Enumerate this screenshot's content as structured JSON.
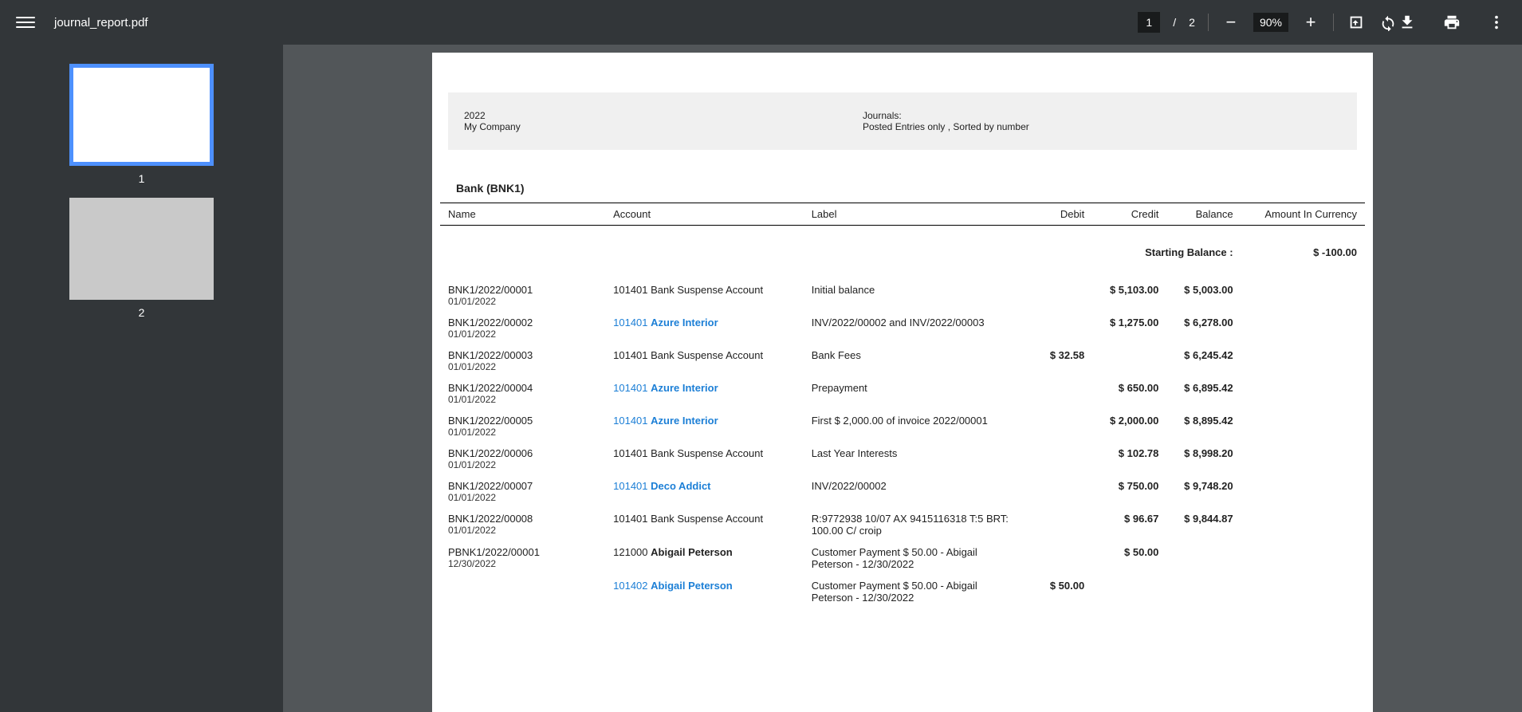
{
  "toolbar": {
    "filename": "journal_report.pdf",
    "page_current": "1",
    "page_total": "2",
    "page_sep": "/",
    "zoom": "90%"
  },
  "thumbnails": {
    "page1": "1",
    "page2": "2"
  },
  "report": {
    "year": "2022",
    "company": "My Company",
    "journals_label": "Journals:",
    "filter_text": "Posted Entries only , Sorted by number",
    "section": "Bank (BNK1)",
    "columns": {
      "name": "Name",
      "account": "Account",
      "label": "Label",
      "debit": "Debit",
      "credit": "Credit",
      "balance": "Balance",
      "amount": "Amount In Currency"
    },
    "starting_balance_label": "Starting Balance :",
    "starting_balance_value": "$ -100.00",
    "rows": [
      {
        "name": "BNK1/2022/00001",
        "date": "01/01/2022",
        "account_code": "101401",
        "account_name": "Bank Suspense Account",
        "account_link": false,
        "label": "Initial balance",
        "debit": "",
        "credit": "$ 5,103.00",
        "balance": "$ 5,003.00"
      },
      {
        "name": "BNK1/2022/00002",
        "date": "01/01/2022",
        "account_code": "101401",
        "account_name": "Azure Interior",
        "account_link": true,
        "label": "INV/2022/00002 and INV/2022/00003",
        "debit": "",
        "credit": "$ 1,275.00",
        "balance": "$ 6,278.00"
      },
      {
        "name": "BNK1/2022/00003",
        "date": "01/01/2022",
        "account_code": "101401",
        "account_name": "Bank Suspense Account",
        "account_link": false,
        "label": "Bank Fees",
        "debit": "$ 32.58",
        "credit": "",
        "balance": "$ 6,245.42"
      },
      {
        "name": "BNK1/2022/00004",
        "date": "01/01/2022",
        "account_code": "101401",
        "account_name": "Azure Interior",
        "account_link": true,
        "label": "Prepayment",
        "debit": "",
        "credit": "$ 650.00",
        "balance": "$ 6,895.42"
      },
      {
        "name": "BNK1/2022/00005",
        "date": "01/01/2022",
        "account_code": "101401",
        "account_name": "Azure Interior",
        "account_link": true,
        "label": "First $ 2,000.00 of invoice 2022/00001",
        "debit": "",
        "credit": "$ 2,000.00",
        "balance": "$ 8,895.42"
      },
      {
        "name": "BNK1/2022/00006",
        "date": "01/01/2022",
        "account_code": "101401",
        "account_name": "Bank Suspense Account",
        "account_link": false,
        "label": "Last Year Interests",
        "debit": "",
        "credit": "$ 102.78",
        "balance": "$ 8,998.20"
      },
      {
        "name": "BNK1/2022/00007",
        "date": "01/01/2022",
        "account_code": "101401",
        "account_name": "Deco Addict",
        "account_link": true,
        "label": "INV/2022/00002",
        "debit": "",
        "credit": "$ 750.00",
        "balance": "$ 9,748.20"
      },
      {
        "name": "BNK1/2022/00008",
        "date": "01/01/2022",
        "account_code": "101401",
        "account_name": "Bank Suspense Account",
        "account_link": false,
        "label": "R:9772938 10/07 AX 9415116318 T:5 BRT: 100.00 C/ croip",
        "debit": "",
        "credit": "$ 96.67",
        "balance": "$ 9,844.87"
      },
      {
        "name": "PBNK1/2022/00001",
        "date": "12/30/2022",
        "account_code": "121000",
        "account_name": "Abigail Peterson",
        "account_link": false,
        "account_bold": true,
        "label": "Customer Payment $ 50.00 - Abigail Peterson - 12/30/2022",
        "debit": "",
        "credit": "$ 50.00",
        "balance": ""
      },
      {
        "name": "",
        "date": "",
        "account_code": "101402",
        "account_name": "Abigail Peterson",
        "account_link": true,
        "label": "Customer Payment $ 50.00 - Abigail Peterson - 12/30/2022",
        "debit": "$ 50.00",
        "credit": "",
        "balance": ""
      }
    ]
  }
}
